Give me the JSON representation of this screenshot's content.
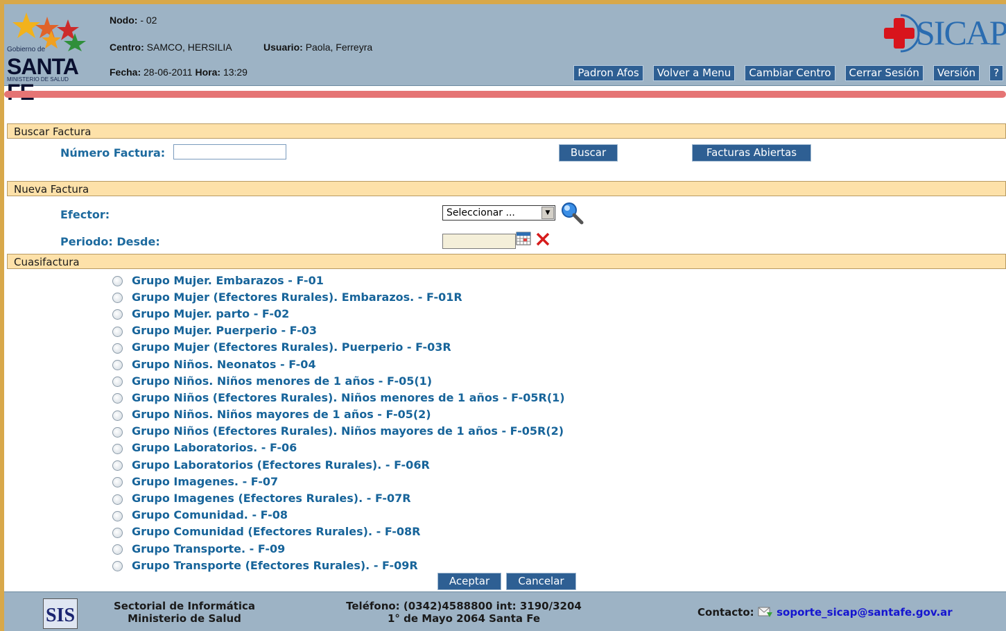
{
  "header": {
    "logo": {
      "gobierno": "Gobierno de",
      "santa_fe": "SANTA FE",
      "ministerio": "MINISTERIO DE SALUD"
    },
    "nodo_label": "Nodo:",
    "nodo_value": "- 02",
    "centro_label": "Centro:",
    "centro_value": "SAMCO, HERSILIA",
    "usuario_label": "Usuario:",
    "usuario_value": "Paola, Ferreyra",
    "fecha_label": "Fecha:",
    "fecha_value": "28-06-2011",
    "hora_label": "Hora:",
    "hora_value": "13:29",
    "brand": "SICAP",
    "buttons": [
      "Padron Afos",
      "Volver a Menu",
      "Cambiar Centro",
      "Cerrar Sesión",
      "Versión",
      "?"
    ]
  },
  "buscar": {
    "title": "Buscar Factura",
    "numero_label": "Número Factura:",
    "numero_value": "",
    "buscar_button": "Buscar",
    "abiertas_button": "Facturas Abiertas"
  },
  "nueva": {
    "title": "Nueva Factura",
    "efector_label": "Efector:",
    "efector_selected": "Seleccionar ...",
    "periodo_label": "Periodo: Desde:",
    "periodo_value": ""
  },
  "cuasifactura": {
    "title": "Cuasifactura",
    "options": [
      "Grupo Mujer. Embarazos - F-01",
      "Grupo Mujer (Efectores Rurales). Embarazos. - F-01R",
      "Grupo Mujer. parto - F-02",
      "Grupo Mujer. Puerperio - F-03",
      "Grupo Mujer (Efectores Rurales). Puerperio - F-03R",
      "Grupo Niños. Neonatos - F-04",
      "Grupo Niños. Niños menores de 1 años - F-05(1)",
      "Grupo Niños (Efectores Rurales). Niños menores de 1 años - F-05R(1)",
      "Grupo Niños. Niños mayores de 1 años - F-05(2)",
      "Grupo Niños (Efectores Rurales). Niños mayores de 1 años - F-05R(2)",
      "Grupo Laboratorios. - F-06",
      "Grupo Laboratorios (Efectores Rurales). - F-06R",
      "Grupo Imagenes. - F-07",
      "Grupo Imagenes (Efectores Rurales). - F-07R",
      "Grupo Comunidad. - F-08",
      "Grupo Comunidad (Efectores Rurales). - F-08R",
      "Grupo Transporte. - F-09",
      "Grupo Transporte (Efectores Rurales). - F-09R"
    ],
    "aceptar_button": "Aceptar",
    "cancelar_button": "Cancelar"
  },
  "footer": {
    "logo_text": "SIS",
    "org_line1": "Sectorial de Informática",
    "org_line2": "Ministerio de Salud",
    "phone_line1": "Teléfono: (0342)4588800 int: 3190/3204",
    "phone_line2": "1° de Mayo 2064 Santa Fe",
    "contact_label": "Contacto:",
    "contact_email": "soporte_sicap@santafe.gov.ar"
  }
}
